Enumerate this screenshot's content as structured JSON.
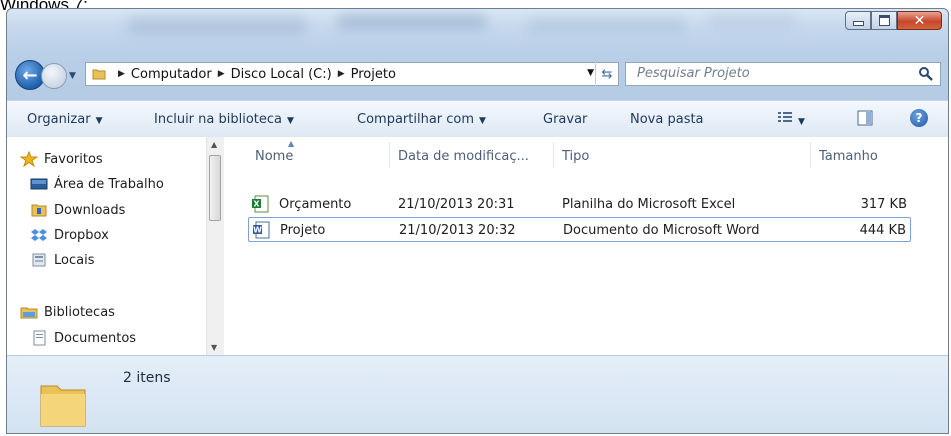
{
  "caption": "Windows 7:",
  "address": {
    "crumbs": [
      "Computador",
      "Disco Local (C:)",
      "Projeto"
    ],
    "search_placeholder": "Pesquisar Projeto"
  },
  "toolbar": {
    "organize": "Organizar",
    "include_library": "Incluir na biblioteca",
    "share_with": "Compartilhar com",
    "burn": "Gravar",
    "new_folder": "Nova pasta"
  },
  "nav": {
    "favorites": "Favoritos",
    "desktop": "Área de Trabalho",
    "downloads": "Downloads",
    "dropbox": "Dropbox",
    "locals": "Locais",
    "libraries": "Bibliotecas",
    "documents": "Documentos"
  },
  "columns": {
    "name": "Nome",
    "date": "Data de modificaç...",
    "type": "Tipo",
    "size": "Tamanho"
  },
  "files": [
    {
      "name": "Orçamento",
      "date": "21/10/2013 20:31",
      "type": "Planilha do Microsoft Excel",
      "size": "317 KB",
      "icon": "excel-icon"
    },
    {
      "name": "Projeto",
      "date": "21/10/2013 20:32",
      "type": "Documento do Microsoft Word",
      "size": "444 KB",
      "icon": "word-icon"
    }
  ],
  "status": {
    "item_count": "2 itens"
  },
  "colors": {
    "accent": "#1d5fae",
    "toolbar_text": "#1e395b",
    "selection_border": "#7da2ce"
  }
}
